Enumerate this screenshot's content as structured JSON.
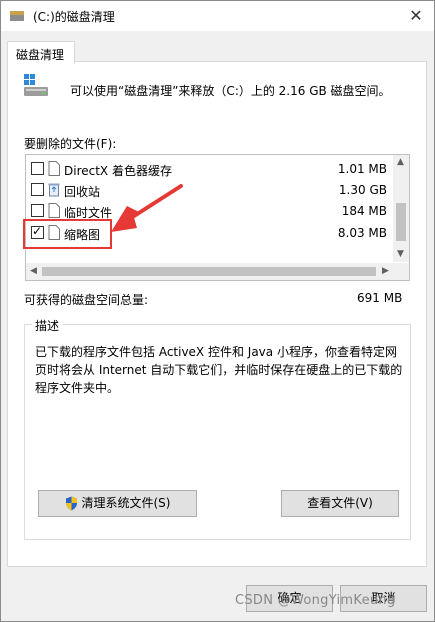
{
  "window": {
    "title": "(C:)的磁盘清理",
    "close_glyph": "✕"
  },
  "tab": {
    "label": "磁盘清理"
  },
  "summary": "可以使用“磁盘清理”来释放（C:）上的 2.16 GB 磁盘空间。",
  "files_label": "要删除的文件(F):",
  "files": [
    {
      "name": "DirectX 着色器缓存",
      "size": "1.01 MB",
      "checked": false,
      "icon": "document-icon"
    },
    {
      "name": "回收站",
      "size": "1.30 GB",
      "checked": false,
      "icon": "recycle-bin-icon"
    },
    {
      "name": "临时文件",
      "size": "184 MB",
      "checked": false,
      "icon": "document-icon"
    },
    {
      "name": "缩略图",
      "size": "8.03 MB",
      "checked": true,
      "icon": "document-icon"
    }
  ],
  "total": {
    "label": "可获得的磁盘空间总量:",
    "value": "691 MB"
  },
  "description": {
    "legend": "描述",
    "text": "已下载的程序文件包括 ActiveX 控件和 Java 小程序，你查看特定网页时将会从 Internet 自动下载它们，并临时保存在硬盘上的已下载的程序文件夹中。"
  },
  "buttons": {
    "cleanup_system": "清理系统文件(S)",
    "view_files": "查看文件(V)",
    "ok": "确定",
    "cancel": "取消"
  },
  "annotation_color": "#e53935",
  "watermark": "CSDN @WongYimKeung"
}
